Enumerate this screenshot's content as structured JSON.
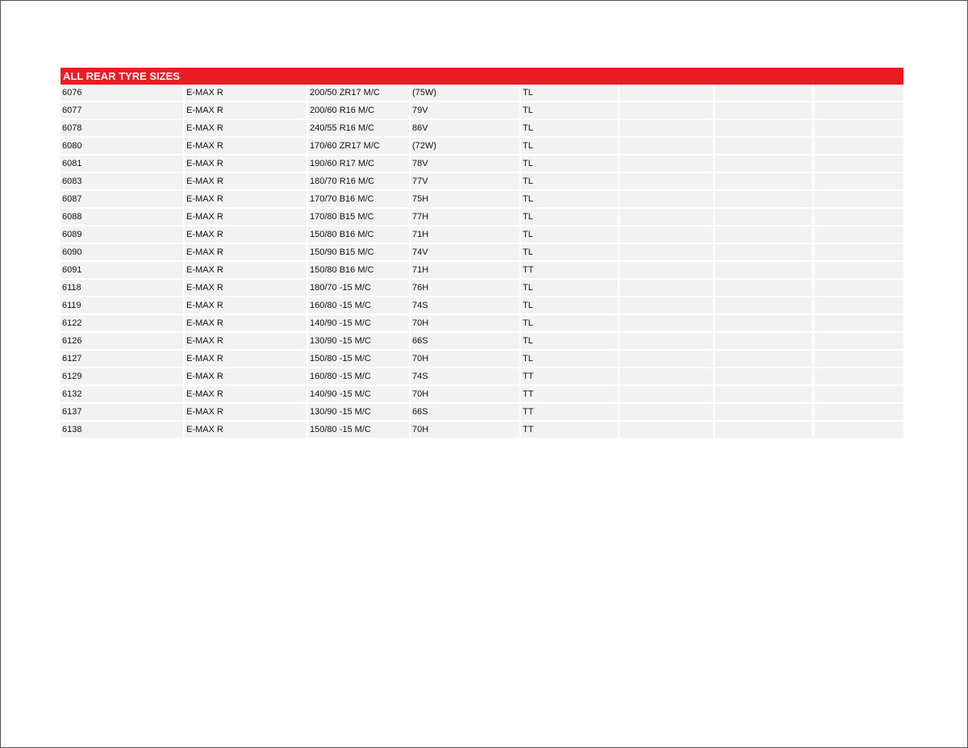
{
  "document": {
    "title": "ALL REAR TYRE SIZES"
  },
  "table": {
    "rows": [
      {
        "code": "6076",
        "pattern": "E-MAX R",
        "size": "200/50 ZR17 M/C",
        "index": "(75W)",
        "type": "TL"
      },
      {
        "code": "6077",
        "pattern": "E-MAX R",
        "size": "200/60 R16 M/C",
        "index": "79V",
        "type": "TL"
      },
      {
        "code": "6078",
        "pattern": "E-MAX R",
        "size": "240/55 R16 M/C",
        "index": "86V",
        "type": "TL"
      },
      {
        "code": "6080",
        "pattern": "E-MAX R",
        "size": "170/60 ZR17 M/C",
        "index": "(72W)",
        "type": "TL"
      },
      {
        "code": "6081",
        "pattern": "E-MAX R",
        "size": "190/60 R17 M/C",
        "index": "78V",
        "type": "TL"
      },
      {
        "code": "6083",
        "pattern": "E-MAX R",
        "size": "180/70 R16 M/C",
        "index": "77V",
        "type": "TL"
      },
      {
        "code": "6087",
        "pattern": "E-MAX R",
        "size": "170/70 B16 M/C",
        "index": "75H",
        "type": "TL"
      },
      {
        "code": "6088",
        "pattern": "E-MAX R",
        "size": "170/80 B15 M/C",
        "index": "77H",
        "type": "TL"
      },
      {
        "code": "6089",
        "pattern": "E-MAX R",
        "size": "150/80 B16 M/C",
        "index": "71H",
        "type": "TL"
      },
      {
        "code": "6090",
        "pattern": "E-MAX R",
        "size": "150/90 B15 M/C",
        "index": "74V",
        "type": "TL"
      },
      {
        "code": "6091",
        "pattern": "E-MAX R",
        "size": "150/80 B16 M/C",
        "index": "71H",
        "type": "TT"
      },
      {
        "code": "6118",
        "pattern": "E-MAX R",
        "size": "180/70 -15 M/C",
        "index": "76H",
        "type": "TL"
      },
      {
        "code": "6119",
        "pattern": "E-MAX R",
        "size": "160/80 -15 M/C",
        "index": "74S",
        "type": "TL"
      },
      {
        "code": "6122",
        "pattern": "E-MAX R",
        "size": "140/90 -15 M/C",
        "index": "70H",
        "type": "TL"
      },
      {
        "code": "6126",
        "pattern": "E-MAX R",
        "size": "130/90 -15 M/C",
        "index": "66S",
        "type": "TL"
      },
      {
        "code": "6127",
        "pattern": "E-MAX R",
        "size": "150/80 -15 M/C",
        "index": "70H",
        "type": "TL"
      },
      {
        "code": "6129",
        "pattern": "E-MAX R",
        "size": "160/80 -15 M/C",
        "index": "74S",
        "type": "TT"
      },
      {
        "code": "6132",
        "pattern": "E-MAX R",
        "size": "140/90 -15 M/C",
        "index": "70H",
        "type": "TT"
      },
      {
        "code": "6137",
        "pattern": "E-MAX R",
        "size": "130/90 -15 M/C",
        "index": "66S",
        "type": "TT"
      },
      {
        "code": "6138",
        "pattern": "E-MAX R",
        "size": "150/80 -15 M/C",
        "index": "70H",
        "type": "TT"
      }
    ]
  },
  "colors": {
    "header_bar": "#ed1c24",
    "header_text": "#ffffff",
    "cell_background": "#f2f2f2"
  }
}
